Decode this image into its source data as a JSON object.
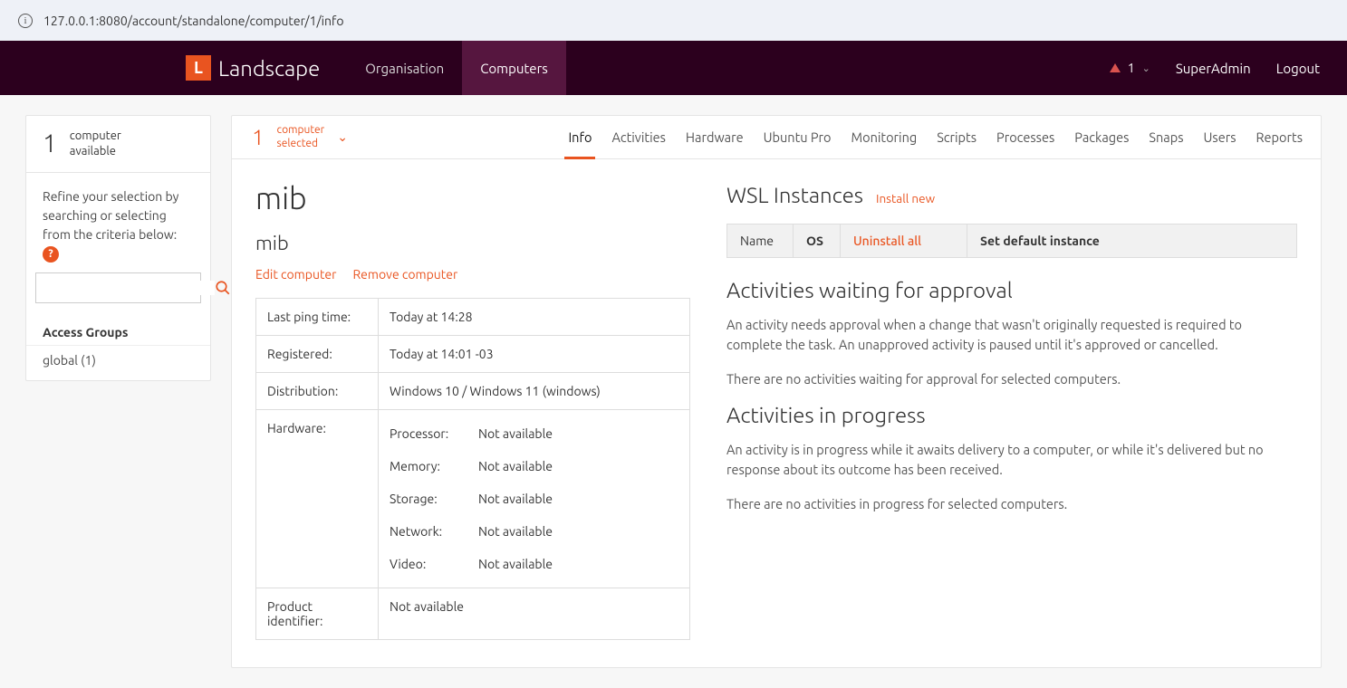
{
  "url": "127.0.0.1:8080/account/standalone/computer/1/info",
  "brand": {
    "logo_letter": "L",
    "name": "Landscape"
  },
  "nav": {
    "items": [
      "Organisation",
      "Computers"
    ],
    "active_index": 1,
    "alert_count": "1",
    "user": "SuperAdmin",
    "logout": "Logout"
  },
  "sidebar": {
    "available_count": "1",
    "available_label_line1": "computer",
    "available_label_line2": "available",
    "refine_text": "Refine your selection by searching or selecting from the criteria below:",
    "search_value": "",
    "access_groups_heading": "Access Groups",
    "groups": [
      {
        "label": "global (1)"
      }
    ]
  },
  "selection": {
    "count": "1",
    "label_line1": "computer",
    "label_line2": "selected",
    "tabs": [
      "Info",
      "Activities",
      "Hardware",
      "Ubuntu Pro",
      "Monitoring",
      "Scripts",
      "Processes",
      "Packages",
      "Snaps",
      "Users",
      "Reports"
    ],
    "active_tab": 0
  },
  "computer": {
    "title": "mib",
    "subtitle": "mib",
    "edit_label": "Edit computer",
    "remove_label": "Remove computer",
    "rows": {
      "last_ping_label": "Last ping time:",
      "last_ping_value": "Today at 14:28",
      "registered_label": "Registered:",
      "registered_value": "Today at 14:01 -03",
      "distribution_label": "Distribution:",
      "distribution_value": "Windows 10 / Windows 11 (windows)",
      "hardware_label": "Hardware:",
      "hardware": [
        {
          "k": "Processor:",
          "v": "Not available"
        },
        {
          "k": "Memory:",
          "v": "Not available"
        },
        {
          "k": "Storage:",
          "v": "Not available"
        },
        {
          "k": "Network:",
          "v": "Not available"
        },
        {
          "k": "Video:",
          "v": "Not available"
        }
      ],
      "product_id_label": "Product identifier:",
      "product_id_value": "Not available"
    }
  },
  "wsl": {
    "title": "WSL Instances",
    "install_label": "Install new",
    "cols": {
      "name": "Name",
      "os": "OS",
      "uninstall": "Uninstall all",
      "set_default": "Set default instance"
    }
  },
  "approval": {
    "title": "Activities waiting for approval",
    "p1": "An activity needs approval when a change that wasn't originally requested is required to complete the task. An unapproved activity is paused until it's approved or cancelled.",
    "p2": "There are no activities waiting for approval for selected computers."
  },
  "progress": {
    "title": "Activities in progress",
    "p1": "An activity is in progress while it awaits delivery to a computer, or while it's delivered but no response about its outcome has been received.",
    "p2": "There are no activities in progress for selected computers."
  }
}
